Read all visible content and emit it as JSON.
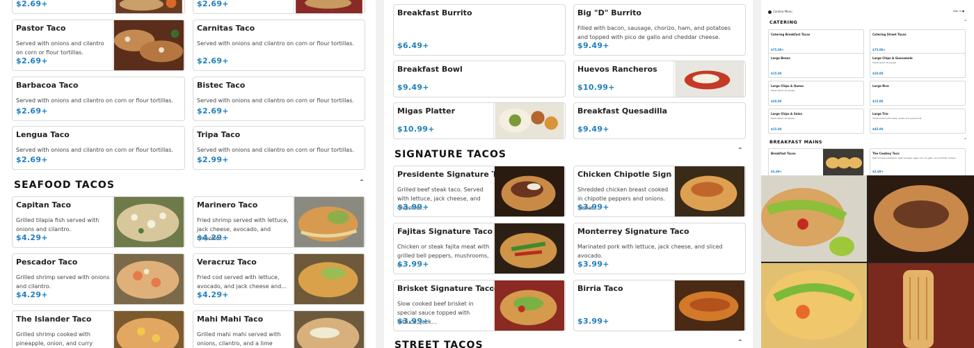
{
  "col1": {
    "top_row": [
      {
        "price": "$2.69+"
      },
      {
        "price": "$2.69+"
      }
    ],
    "tacos": [
      {
        "name": "Pastor Taco",
        "desc": "Served with onions and cilantro on corn or flour tortillas.",
        "price": "$2.69+",
        "photo": true
      },
      {
        "name": "Carnitas Taco",
        "desc": "Served with onions and cilantro on corn or flour tortillas.",
        "price": "$2.69+",
        "photo": false
      },
      {
        "name": "Barbacoa Taco",
        "desc": "Served with onions and cilantro on corn or flour tortillas.",
        "price": "$2.69+",
        "photo": false
      },
      {
        "name": "Bistec Taco",
        "desc": "Served with onions and cilantro on corn or flour tortillas.",
        "price": "$2.69+",
        "photo": false
      },
      {
        "name": "Lengua Taco",
        "desc": "Served with onions and cilantro on corn or flour tortillas.",
        "price": "$2.69+",
        "photo": false
      },
      {
        "name": "Tripa Taco",
        "desc": "Served with onions and cilantro on corn or flour tortillas.",
        "price": "$2.99+",
        "photo": false
      }
    ],
    "seafood_title": "SEAFOOD TACOS",
    "seafood": [
      {
        "name": "Capitan Taco",
        "desc": "Grilled tilapia fish served with onions and cilantro.",
        "price": "$4.29+"
      },
      {
        "name": "Marinero Taco",
        "desc": "Fried shrimp served with lettuce, jack cheese, avocado, and chipotle...",
        "price": "$4.29+"
      },
      {
        "name": "Pescador Taco",
        "desc": "Grilled shrimp served with onions and cilantro.",
        "price": "$4.29+"
      },
      {
        "name": "Veracruz Taco",
        "desc": "Fried cod served with lettuce, avocado, and jack cheese and...",
        "price": "$4.29+"
      },
      {
        "name": "The Islander Taco",
        "desc": "Grilled shrimp cooked with pineapple, onion, and curry powder...",
        "price": ""
      },
      {
        "name": "Mahi Mahi Taco",
        "desc": "Grilled mahi mahi served with onions, cilantro, and a lime wedge.",
        "price": ""
      }
    ]
  },
  "col2": {
    "breakfast": [
      {
        "name": "Breakfast Burrito",
        "desc": "",
        "price": "$6.49+"
      },
      {
        "name": "Big \"D\" Burrito",
        "desc": "Filled with bacon, sausage, chorizo, ham, and potatoes and topped with pico de gallo and cheddar cheese.",
        "price": "$9.49+"
      },
      {
        "name": "Breakfast Bowl",
        "desc": "",
        "price": "$9.49+"
      },
      {
        "name": "Huevos Rancheros",
        "desc": "",
        "price": "$10.99+"
      },
      {
        "name": "Migas Platter",
        "desc": "",
        "price": "$10.99+"
      },
      {
        "name": "Breakfast Quesadilla",
        "desc": "",
        "price": "$9.49+"
      }
    ],
    "signature_title": "SIGNATURE TACOS",
    "signature": [
      {
        "name": "Presidente Signature Taco",
        "desc": "Grilled beef steak taco. Served with lettuce, jack cheese, and chipotle...",
        "price": "$3.99+"
      },
      {
        "name": "Chicken Chipotle Signatur...",
        "desc": "Shredded chicken breast cooked in chipotle peppers and onions. Serve...",
        "price": "$3.99+"
      },
      {
        "name": "Fajitas Signature Taco",
        "desc": "Chicken or steak fajita meat with grilled bell peppers, mushrooms, a...",
        "price": "$3.99+"
      },
      {
        "name": "Monterrey Signature Taco",
        "desc": "Marinated pork with lettuce, jack cheese, and sliced avocado.",
        "price": "$3.99+"
      },
      {
        "name": "Brisket Signature Taco",
        "desc": "Slow cooked beef brisket in special sauce topped with lettuce, jack...",
        "price": "$3.99+"
      },
      {
        "name": "Birria Taco",
        "desc": "",
        "price": "$3.99+"
      }
    ],
    "street_title": "STREET TACOS"
  },
  "col3": {
    "logo": "Cantina Menu",
    "right_text": "Sign in ●",
    "catering_title": "CATERING",
    "catering": [
      {
        "name": "Catering Breakfast Tacos",
        "desc": "",
        "price": "$75.00+"
      },
      {
        "name": "Catering Street Tacos",
        "desc": "",
        "price": "$75.00+"
      },
      {
        "name": "Large Beans",
        "desc": "",
        "price": "$15.00"
      },
      {
        "name": "Large Chips & Guacamole",
        "desc": "Feeds about 10 people",
        "price": "$20.00"
      },
      {
        "name": "Large Chips & Queso",
        "desc": "Feeds about 10 people",
        "price": "$20.00"
      },
      {
        "name": "Large Rice",
        "desc": "",
        "price": "$15.00"
      },
      {
        "name": "Large Chips & Salsa",
        "desc": "Feeds about 10 people",
        "price": "$15.00"
      },
      {
        "name": "Large Trio",
        "desc": "Chips served with salsa, queso and guacamole",
        "price": "$45.00"
      }
    ],
    "mains_title": "BREAKFAST MAINS",
    "mains": [
      {
        "name": "Breakfast Tacos",
        "desc": "",
        "price": "$2.69+"
      },
      {
        "name": "The Cowboy Taco",
        "desc": "With smoked jalapeños, beef sausage, eggs, pico de gallo, and cheddar cheese.",
        "price": "$2.69+"
      }
    ]
  },
  "colors": {
    "price": "#1f7fbf",
    "border": "#d8d8d8"
  }
}
